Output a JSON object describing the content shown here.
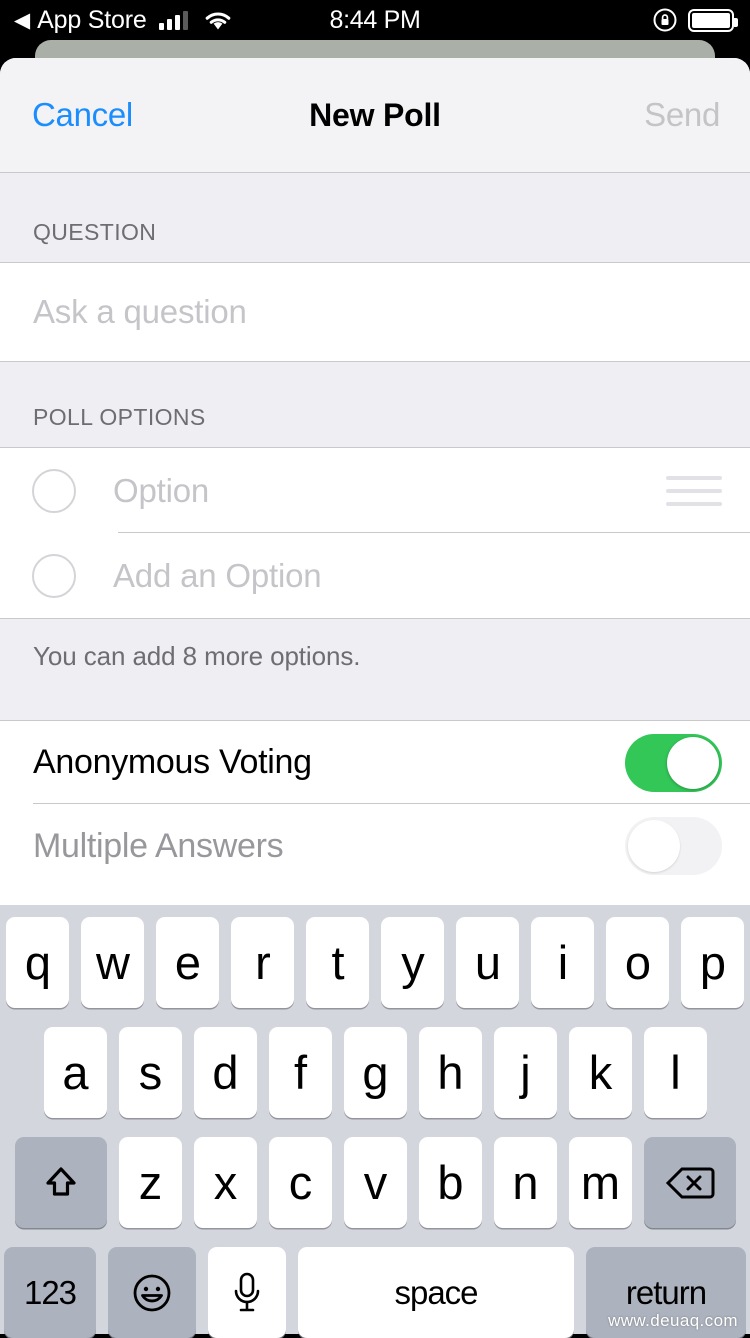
{
  "status_bar": {
    "back_glyph": "◀",
    "app_name": "App Store",
    "time": "8:44 PM",
    "signal_icon": "cellular-signal-icon",
    "wifi_icon": "wifi-icon",
    "rotation_lock_icon": "rotation-lock-icon",
    "battery_icon": "battery-full-icon"
  },
  "navbar": {
    "cancel_label": "Cancel",
    "title": "New Poll",
    "send_label": "Send",
    "cancel_color": "#1b8dfd",
    "send_color": "#c4c4c8"
  },
  "question_section": {
    "header": "QUESTION",
    "input_placeholder": "Ask a question",
    "input_value": ""
  },
  "poll_options_section": {
    "header": "POLL OPTIONS",
    "options": [
      {
        "placeholder": "Option",
        "value": "",
        "has_drag_handle": true
      },
      {
        "placeholder": "Add an Option",
        "value": "",
        "has_drag_handle": false
      }
    ],
    "footer_note": "You can add 8 more options."
  },
  "settings_section": {
    "rows": [
      {
        "label": "Anonymous Voting",
        "enabled": true,
        "toggle_on": true
      },
      {
        "label": "Multiple Answers",
        "enabled": false,
        "toggle_on": false
      }
    ],
    "toggle_on_color": "#33c758",
    "toggle_off_color": "#e9e9ec"
  },
  "keyboard": {
    "row1": [
      "q",
      "w",
      "e",
      "r",
      "t",
      "y",
      "u",
      "i",
      "o",
      "p"
    ],
    "row2": [
      "a",
      "s",
      "d",
      "f",
      "g",
      "h",
      "j",
      "k",
      "l"
    ],
    "row3_letters": [
      "z",
      "x",
      "c",
      "v",
      "b",
      "n",
      "m"
    ],
    "shift_icon": "shift-arrow-icon",
    "backspace_icon": "backspace-delete-icon",
    "numbers_label": "123",
    "emoji_icon": "smiley-face-icon",
    "dictation_icon": "microphone-icon",
    "space_label": "space",
    "return_label": "return",
    "background_color": "#d3d7dd",
    "key_color": "#ffffff",
    "modifier_key_color": "#adb3be"
  },
  "watermark": {
    "text": "www.deuaq.com"
  }
}
